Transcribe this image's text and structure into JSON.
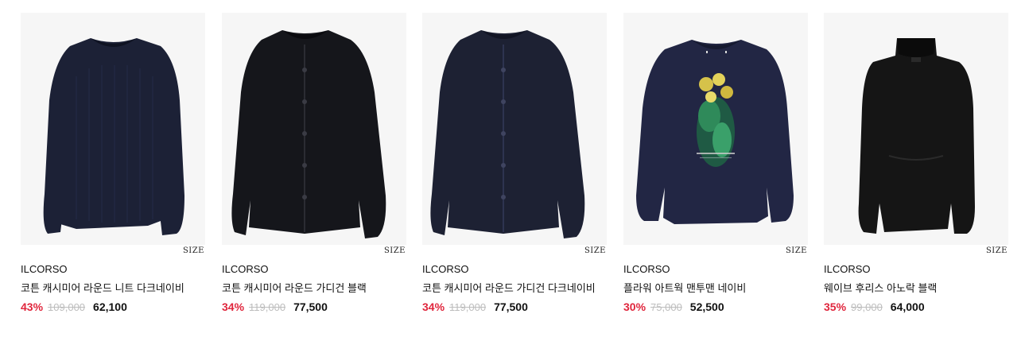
{
  "products": [
    {
      "brand": "ILCORSO",
      "name": "코튼 캐시미어 라운드 니트 다크네이비",
      "discount": "43%",
      "original_price": "109,000",
      "price": "62,100",
      "size_label": "SIZE",
      "color": "#1c2136"
    },
    {
      "brand": "ILCORSO",
      "name": "코튼 캐시미어 라운드 가디건 블랙",
      "discount": "34%",
      "original_price": "119,000",
      "price": "77,500",
      "size_label": "SIZE",
      "color": "#15161b"
    },
    {
      "brand": "ILCORSO",
      "name": "코튼 캐시미어 라운드 가디건 다크네이비",
      "discount": "34%",
      "original_price": "119,000",
      "price": "77,500",
      "size_label": "SIZE",
      "color": "#1d2133"
    },
    {
      "brand": "ILCORSO",
      "name": "플라워 아트웍 맨투맨 네이비",
      "discount": "30%",
      "original_price": "75,000",
      "price": "52,500",
      "size_label": "SIZE",
      "color": "#222644"
    },
    {
      "brand": "ILCORSO",
      "name": "웨이브 후리스 아노락 블랙",
      "discount": "35%",
      "original_price": "99,000",
      "price": "64,000",
      "size_label": "SIZE",
      "color": "#151515"
    }
  ],
  "colors": {
    "discount": "#e0253c",
    "strike": "#bdbdbd",
    "thumb_bg": "#f6f6f6"
  }
}
